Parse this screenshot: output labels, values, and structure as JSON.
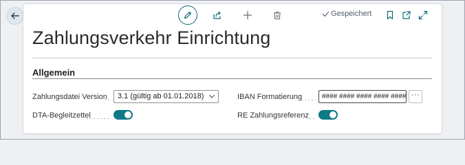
{
  "toolbar": {
    "back_icon": "arrow-left-icon",
    "edit_icon": "pencil-icon",
    "share_icon": "share-icon",
    "new_icon": "plus-icon",
    "delete_icon": "trash-icon",
    "saved_label": "Gespeichert",
    "bookmark_icon": "bookmark-icon",
    "open_new_window_icon": "open-in-new-window-icon",
    "expand_icon": "expand-icon"
  },
  "page": {
    "title": "Zahlungsverkehr Einrichtung"
  },
  "section": {
    "title": "Allgemein",
    "fields": {
      "zahlungsdatei_version": {
        "label": "Zahlungsdatei Version",
        "value": "3.1 (gültig ab 01.01.2018)"
      },
      "iban_formatierung": {
        "label": "IBAN Formatierung",
        "value": "#### #### #### #### ####",
        "more_label": "···"
      },
      "dta_begleitzettel": {
        "label": "DTA-Begleitzettel",
        "value": true
      },
      "re_zahlungsreferenz": {
        "label": "RE Zahlungsreferenz",
        "value": true
      }
    }
  },
  "colors": {
    "accent": "#0e7a86",
    "background": "#eef0f3"
  }
}
